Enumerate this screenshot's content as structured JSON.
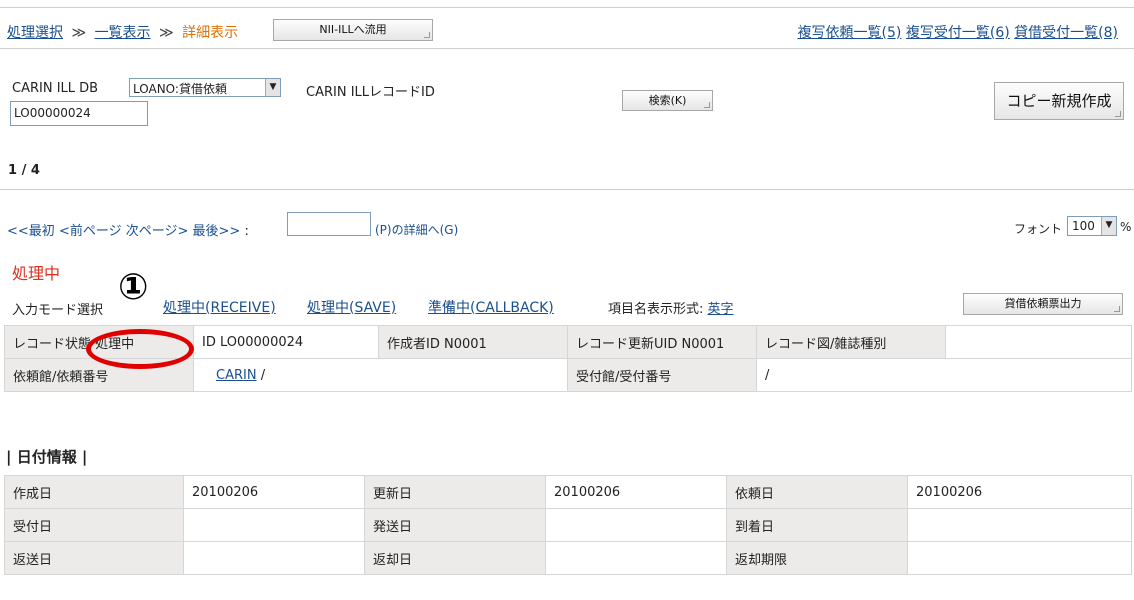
{
  "top_nav": {
    "crumb1": "処理選択",
    "sep1": "≫",
    "crumb2": "一覧表示",
    "sep2": "≫",
    "current": "詳細表示",
    "nii_button": "NII-ILLへ流用",
    "link_copy_req": "複写依頼一覧(5)",
    "link_copy_recv": "複写受付一覧(6)",
    "link_loan_recv": "貸借受付一覧(8)"
  },
  "search": {
    "db_label": "CARIN ILL DB",
    "db_select": "LOANO:貸借依頼",
    "record_id_label": "CARIN ILLレコードID",
    "record_id_value": "LO00000024",
    "search_button": "検索(K)",
    "copy_new_button": "コピー新規作成"
  },
  "page_count": "1 / 4",
  "pager": {
    "first": "<<最初",
    "prev": "<前ページ",
    "next": "次ページ>",
    "last": "最後>>",
    "colon": ":",
    "input_value": "",
    "detail_link": "(P)の詳細へ(G)",
    "font_label": "フォント",
    "font_value": "100",
    "percent": "%"
  },
  "status": {
    "title": "処理中",
    "mode_label": "入力モード選択",
    "mode_receive": "処理中(RECEIVE)",
    "mode_save": "処理中(SAVE)",
    "mode_callback": "準備中(CALLBACK)",
    "item_format_label": "項目名表示形式:",
    "item_format_value": "英字",
    "print_button": "貸借依頼票出力"
  },
  "annotation": {
    "marker": "①",
    "accent_color": "#e00000"
  },
  "record_table": {
    "r1": [
      "レコード状態 処理中",
      "ID LO00000024",
      "作成者ID N0001",
      "レコード更新UID N0001",
      "レコード図/雑誌種別",
      ""
    ],
    "r2_label1": "依頼館/依頼番号",
    "r2_link": "CARIN",
    "r2_rest": " /",
    "r2_label2": "受付館/受付番号",
    "r2_value2": "/"
  },
  "date_section": {
    "heading": "| 日付情報 |",
    "rows": [
      [
        "作成日",
        "20100206",
        "更新日",
        "20100206",
        "依頼日",
        "20100206"
      ],
      [
        "受付日",
        "",
        "発送日",
        "",
        "到着日",
        ""
      ],
      [
        "返送日",
        "",
        "返却日",
        "",
        "返却期限",
        ""
      ]
    ]
  }
}
